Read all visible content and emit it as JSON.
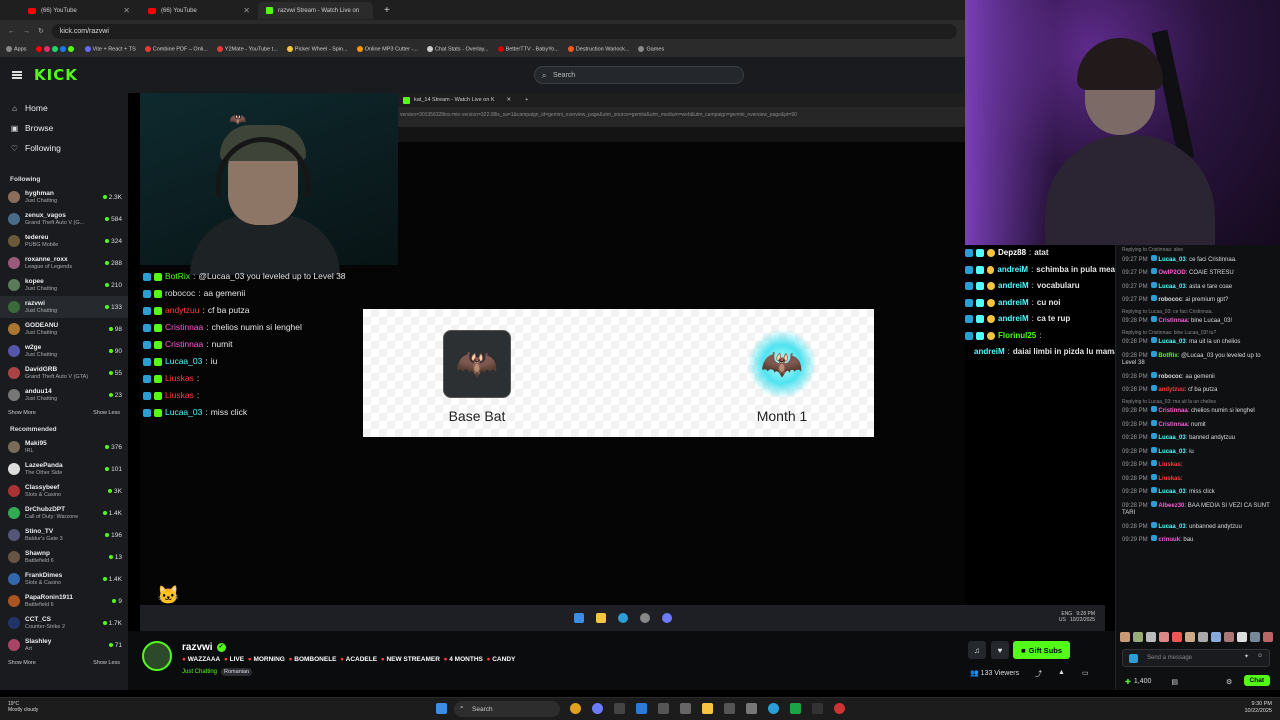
{
  "browser": {
    "tabs": [
      {
        "label": "(66) YouTube",
        "icon": "youtube"
      },
      {
        "label": "(66) YouTube",
        "icon": "youtube"
      },
      {
        "label": "razvwi Stream - Watch Live on",
        "icon": "kick"
      }
    ],
    "url": "kick.com/razvwi",
    "bookmarks": [
      "Apps",
      "Vite + React + TS",
      "Combine PDF – Onli...",
      "Y2Mate - YouTube t...",
      "Picker Wheel - Spin...",
      "Online MP3 Cutter -...",
      "Chat Stats - Overlay...",
      "BetterTTV - BabyYo...",
      "Destruction Warlock...",
      "Games"
    ]
  },
  "header": {
    "logo": "KICK",
    "search_placeholder": "Search"
  },
  "sidebar": {
    "nav": [
      {
        "label": "Home",
        "icon": "home-icon"
      },
      {
        "label": "Browse",
        "icon": "browse-icon"
      },
      {
        "label": "Following",
        "icon": "heart-icon"
      }
    ],
    "following_title": "Following",
    "following": [
      {
        "name": "hyghman",
        "game": "Just Chatting",
        "viewers": "2.3K",
        "color": "#8a6d5a"
      },
      {
        "name": "zenux_vagos",
        "game": "Grand Theft Auto V (G...",
        "viewers": "584",
        "color": "#4a6a8a"
      },
      {
        "name": "tedereu",
        "game": "PUBG Mobile",
        "viewers": "324",
        "color": "#6a5a3a"
      },
      {
        "name": "roxanne_roxx",
        "game": "League of Legends",
        "viewers": "288",
        "color": "#9a5a7a"
      },
      {
        "name": "kopee",
        "game": "Just Chatting",
        "viewers": "210",
        "color": "#5a7a5a"
      },
      {
        "name": "razvwi",
        "game": "Just Chatting",
        "viewers": "133",
        "color": "#3a6a3a"
      },
      {
        "name": "GODEANU",
        "game": "Just Chatting",
        "viewers": "98",
        "color": "#aa7733"
      },
      {
        "name": "w2ge",
        "game": "Just Chatting",
        "viewers": "90",
        "color": "#5555aa"
      },
      {
        "name": "DavidGRB",
        "game": "Grand Theft Auto V (GTA)",
        "viewers": "55",
        "color": "#aa4444"
      },
      {
        "name": "anduu14",
        "game": "Just Chatting",
        "viewers": "23",
        "color": "#777777"
      }
    ],
    "show_more": "Show More",
    "show_less": "Show Less",
    "recommended_title": "Recommended",
    "recommended": [
      {
        "name": "Maki95",
        "game": "IRL",
        "viewers": "376",
        "color": "#7a6a5a"
      },
      {
        "name": "LazeePanda",
        "game": "The Other Side",
        "viewers": "101",
        "color": "#dddddd"
      },
      {
        "name": "Classybeef",
        "game": "Slots & Casino",
        "viewers": "3K",
        "color": "#aa3333"
      },
      {
        "name": "DrChubzDPT",
        "game": "Call of Duty: Warzone",
        "viewers": "1.4K",
        "color": "#33aa55"
      },
      {
        "name": "Stino_TV",
        "game": "Baldur's Gate 3",
        "viewers": "196",
        "color": "#555577"
      },
      {
        "name": "Shawnp",
        "game": "Battlefield 6",
        "viewers": "13",
        "color": "#665544"
      },
      {
        "name": "FrankDimes",
        "game": "Slots & Casino",
        "viewers": "1.4K",
        "color": "#3366aa"
      },
      {
        "name": "PapaRonin1911",
        "game": "Battlefield 6",
        "viewers": "9",
        "color": "#aa5522"
      },
      {
        "name": "CCT_CS",
        "game": "Counter-Strike 2",
        "viewers": "1.7K",
        "color": "#223366"
      },
      {
        "name": "Slashley",
        "game": "Art",
        "viewers": "71",
        "color": "#aa4466"
      }
    ]
  },
  "stream": {
    "inner_tab": "kat_14 Stream - Watch Live on K",
    "inner_url": "version=301356328ios-min-version=322.08is_sa=1&campaign_id=gemini_overview_page&utm_source=gemini&utm_medium=web&utm_campaign=gemini_overview_page&pt=90",
    "overlay_chat": [
      {
        "user": "BotRix",
        "text": "@Lucaa_03 you leveled up to Level 38",
        "color": "#53fc18"
      },
      {
        "user": "robococ",
        "text": "aa gemenii",
        "color": "#dddddd"
      },
      {
        "user": "andytzuu",
        "text": "cf ba putza",
        "color": "#ff3b3b"
      },
      {
        "user": "Cristinnaa",
        "text": "chelios numin si lenghel",
        "color": "#ff59d6"
      },
      {
        "user": "Cristinnaa",
        "text": "numit",
        "color": "#ff59d6"
      },
      {
        "user": "Lucaa_03",
        "text": "iu",
        "color": "#53fcff"
      },
      {
        "user": "Liuskas",
        "text": "",
        "color": "#ff3b3b"
      },
      {
        "user": "Liuskas",
        "text": "",
        "color": "#ff3b3b"
      },
      {
        "user": "Lucaa_03",
        "text": "miss click",
        "color": "#53fcff"
      }
    ],
    "reward": {
      "left_label": "Base Bat",
      "right_label": "Month 1"
    },
    "tray_lang": "ENG",
    "tray_region": "US",
    "tray_time": "9:28 PM",
    "tray_date": "10/22/2025"
  },
  "overlay_chat2": [
    {
      "user": "Depz88",
      "text": "atat",
      "color": "#ffffff"
    },
    {
      "user": "andreiM",
      "text": "schimba in pula mea",
      "color": "#53fcff"
    },
    {
      "user": "andreiM",
      "text": "vocabularu",
      "color": "#53fcff"
    },
    {
      "user": "andreiM",
      "text": "cu noi",
      "color": "#53fcff"
    },
    {
      "user": "andreiM",
      "text": "ca te rup",
      "color": "#53fcff"
    },
    {
      "user": "Florinul25",
      "text": "",
      "color": "#53fc18"
    },
    {
      "user": "andreiM",
      "text": "daiai limbi in pizda lu mamaie",
      "color": "#53fcff"
    }
  ],
  "chat": {
    "messages": [
      {
        "reply": "Replying to Cristinnaa: aloo",
        "time": "09:27 PM",
        "user": "Lucaa_03",
        "text": "ce faci Cristinnaa.",
        "color": "#53fcff"
      },
      {
        "reply": "",
        "time": "09:27 PM",
        "user": "OwIP2OD",
        "text": "COAIE STRESU",
        "color": "#ff59d6"
      },
      {
        "reply": "",
        "time": "09:27 PM",
        "user": "Lucaa_03",
        "text": "asta e tare coae",
        "color": "#53fcff"
      },
      {
        "reply": "",
        "time": "09:27 PM",
        "user": "robococ",
        "text": "ai premium gpt?",
        "color": "#dddddd"
      },
      {
        "reply": "Replying to Lucaa_03: ce faci Cristinnaa.",
        "time": "09:28 PM",
        "user": "Cristinnaa",
        "text": "bine Lucaa_03!",
        "color": "#ff59d6"
      },
      {
        "reply": "Replying to Cristinnaa: bine Lucaa_03! tu?",
        "time": "09:28 PM",
        "user": "Lucaa_03",
        "text": "ma uit la un chelios",
        "color": "#53fcff"
      },
      {
        "reply": "",
        "time": "09:28 PM",
        "user": "BotRix",
        "text": "@Lucaa_03 you leveled up to Level 38",
        "color": "#53fc18"
      },
      {
        "reply": "",
        "time": "09:28 PM",
        "user": "robococ",
        "text": "aa gemenii",
        "color": "#dddddd"
      },
      {
        "reply": "",
        "time": "09:28 PM",
        "user": "andytzuu",
        "text": "cf ba putza",
        "color": "#ff3b3b"
      },
      {
        "reply": "Replying to Lucaa_03: ma uit la un chelios",
        "time": "09:28 PM",
        "user": "Cristinnaa",
        "text": "chelios numin si lenghel",
        "color": "#ff59d6"
      },
      {
        "reply": "",
        "time": "09:28 PM",
        "user": "Cristinnaa",
        "text": "numit",
        "color": "#ff59d6"
      },
      {
        "reply": "",
        "time": "09:28 PM",
        "user": "Lucaa_03",
        "text": "banned andytzuu",
        "color": "#53fcff"
      },
      {
        "reply": "",
        "time": "09:28 PM",
        "user": "Lucaa_03",
        "text": "iu",
        "color": "#53fcff"
      },
      {
        "reply": "",
        "time": "09:28 PM",
        "user": "Liuskas",
        "text": "",
        "color": "#ff3b3b"
      },
      {
        "reply": "",
        "time": "09:28 PM",
        "user": "Liuskas",
        "text": "",
        "color": "#ff3b3b"
      },
      {
        "reply": "",
        "time": "09:28 PM",
        "user": "Lucaa_03",
        "text": "miss click",
        "color": "#53fcff"
      },
      {
        "reply": "",
        "time": "09:28 PM",
        "user": "Albeez30",
        "text": "BAA MEDIA SI VEZI CA SUNT TARI",
        "color": "#ff59d6"
      },
      {
        "reply": "",
        "time": "09:28 PM",
        "user": "Lucaa_03",
        "text": "unbanned andytzuu",
        "color": "#53fcff"
      },
      {
        "reply": "",
        "time": "09:29 PM",
        "user": "crinuuk",
        "text": "bau",
        "color": "#ff59d6"
      }
    ],
    "input_placeholder": "Send a message",
    "points": "1,400",
    "send_label": "Chat"
  },
  "channel": {
    "name": "razvwi",
    "title_tags": [
      "WAZZAAA",
      "LIVE",
      "MORNING",
      "BOMBONELE",
      "ACADELE",
      "NEW STREAMER",
      "4 MONTHS",
      "CANDY"
    ],
    "category": "Just Chatting",
    "language": "Romanian",
    "gift_label": "Gift Subs",
    "viewers": "133 Viewers"
  },
  "taskbar": {
    "weather_temp": "19°C",
    "weather_desc": "Mostly cloudy",
    "search": "Search",
    "time": "9:30 PM",
    "date": "10/22/2025"
  }
}
